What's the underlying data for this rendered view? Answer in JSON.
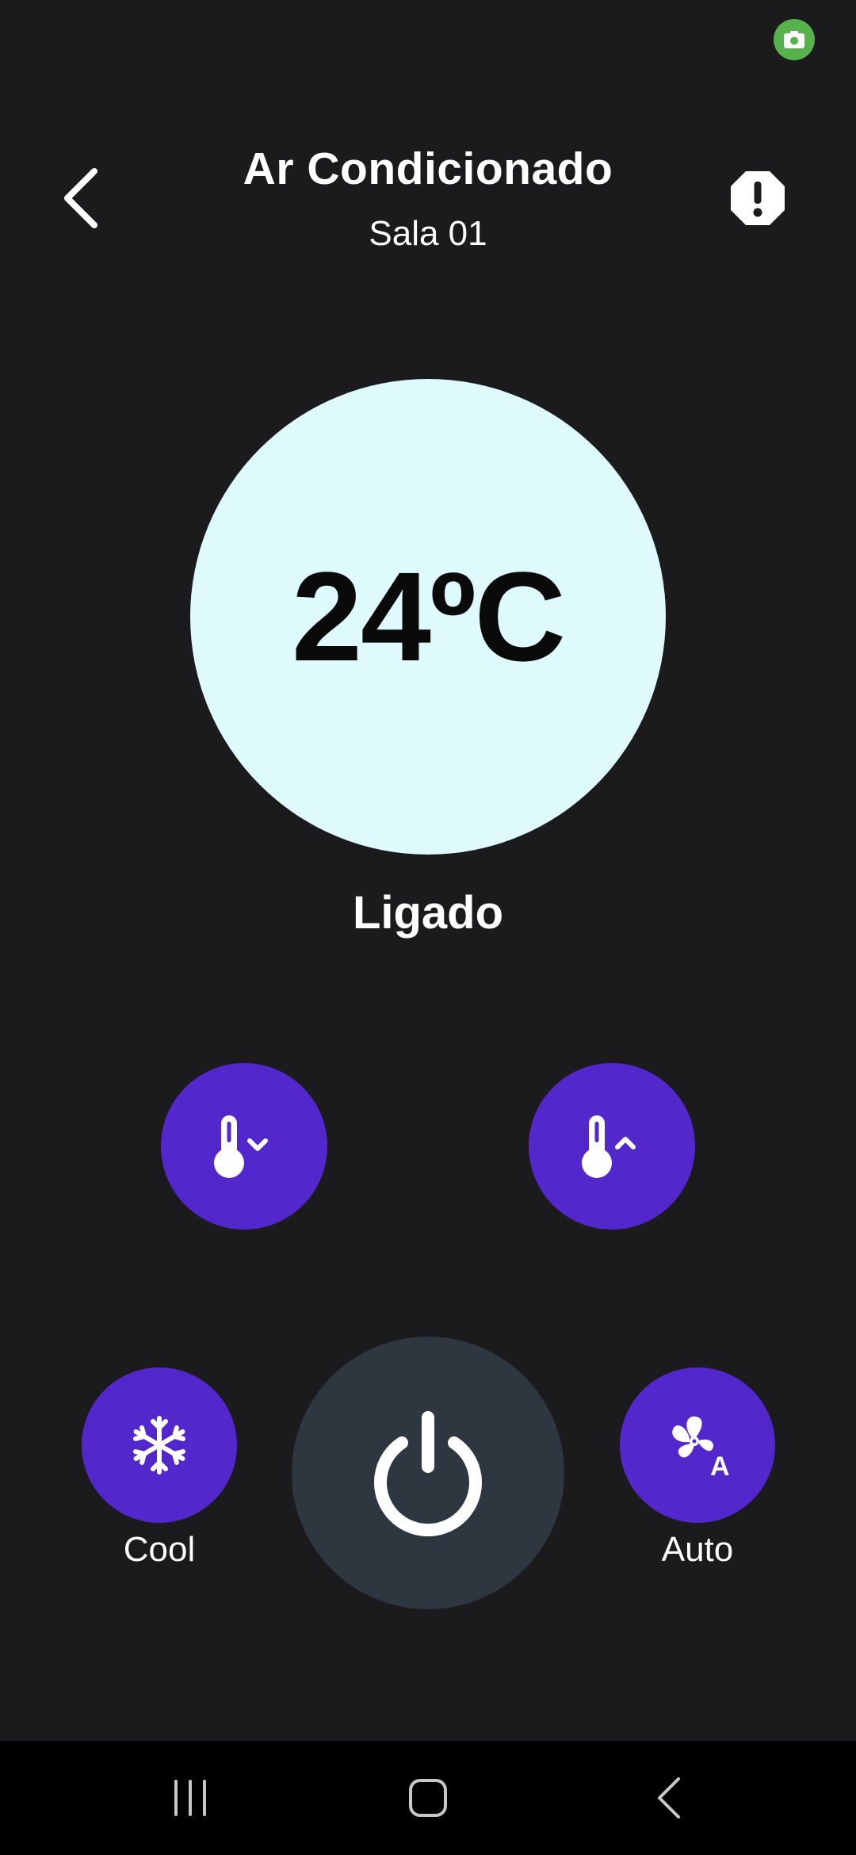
{
  "header": {
    "title": "Ar Condicionado",
    "subtitle": "Sala 01",
    "back_icon": "chevron-left-icon",
    "alert_icon": "alert-octagon-icon"
  },
  "status": {
    "temperature": "24ºC",
    "state": "Ligado"
  },
  "controls": {
    "temp_down_icon": "thermometer-down-icon",
    "temp_up_icon": "thermometer-up-icon",
    "mode_label": "Cool",
    "mode_icon": "snowflake-icon",
    "power_icon": "power-icon",
    "fan_label": "Auto",
    "fan_icon": "fan-auto-icon"
  },
  "colors": {
    "background": "#1b1b1d",
    "accent": "#5227cc",
    "temp_circle": "#dffafd",
    "power_button": "#2e3640",
    "recording_indicator": "#58b24b"
  },
  "navbar": {
    "items": [
      "recent-apps-icon",
      "home-icon",
      "back-icon"
    ]
  }
}
